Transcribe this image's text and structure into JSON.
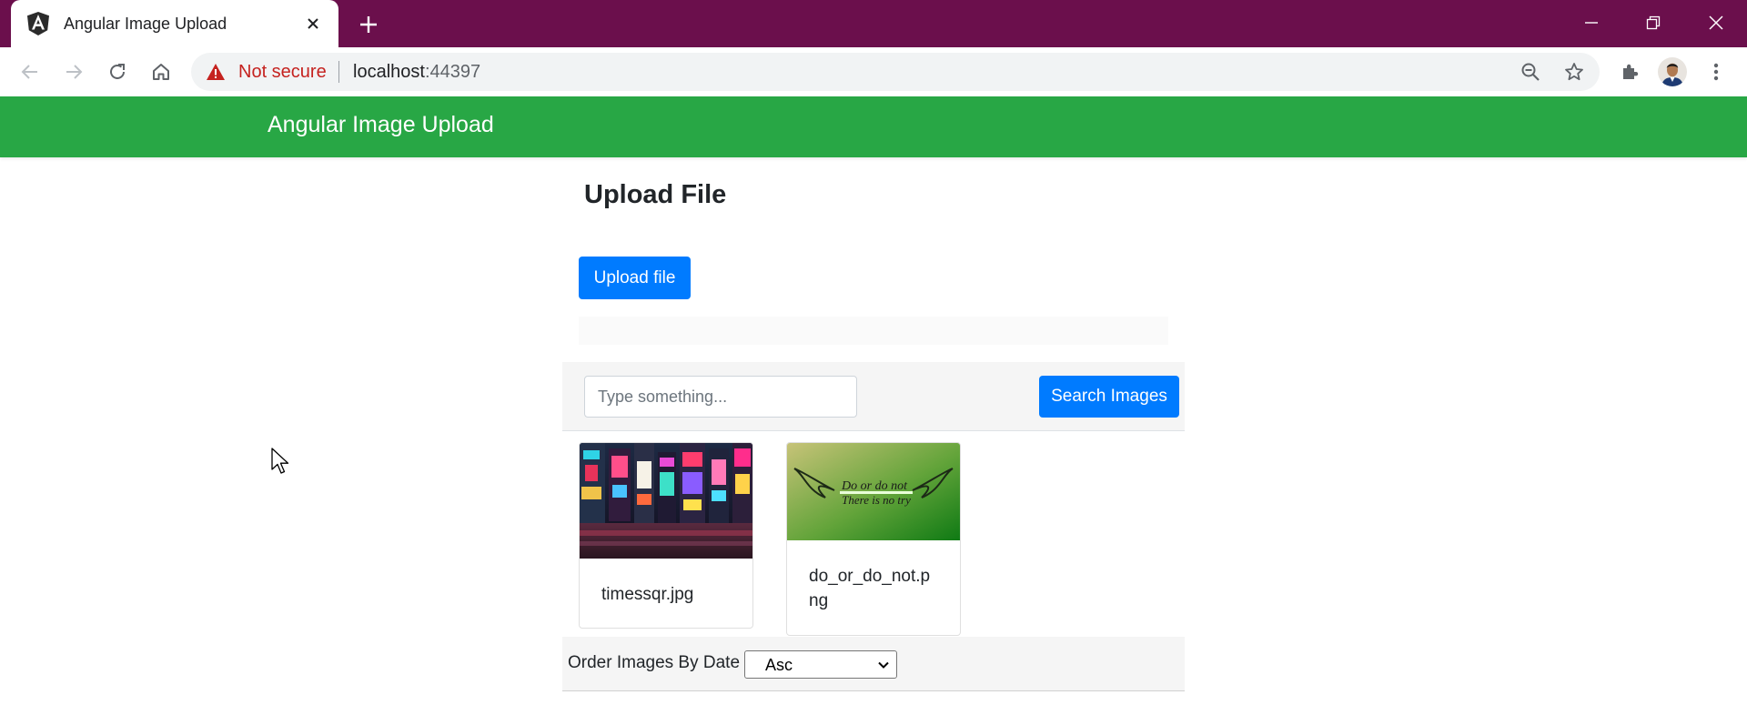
{
  "browser": {
    "tab_title": "Angular Image Upload",
    "security_label": "Not secure",
    "url_host": "localhost",
    "url_port": ":44397"
  },
  "app": {
    "brand": "Angular Image Upload",
    "upload_title": "Upload File",
    "upload_button": "Upload file",
    "search": {
      "placeholder": "Type something...",
      "value": "",
      "button": "Search Images"
    },
    "images": [
      {
        "filename": "timessqr.jpg"
      },
      {
        "filename": "do_or_do_not.png",
        "image_text_line1": "Do or do not",
        "image_text_line2": "There is no try"
      }
    ],
    "order": {
      "label": "Order Images By Date :",
      "selected": "Asc"
    }
  },
  "colors": {
    "titlebar": "#6b0f4c",
    "navbar": "#28a745",
    "primary_button": "#007bff",
    "not_secure": "#c5221f"
  },
  "icons": [
    "angular-favicon-icon",
    "close-icon",
    "plus-icon",
    "minimize-icon",
    "restore-icon",
    "back-arrow-icon",
    "forward-arrow-icon",
    "reload-icon",
    "home-icon",
    "warning-icon",
    "zoom-out-icon",
    "star-icon",
    "extensions-icon",
    "kebab-menu-icon",
    "chevron-down-icon",
    "mouse-cursor-icon"
  ]
}
